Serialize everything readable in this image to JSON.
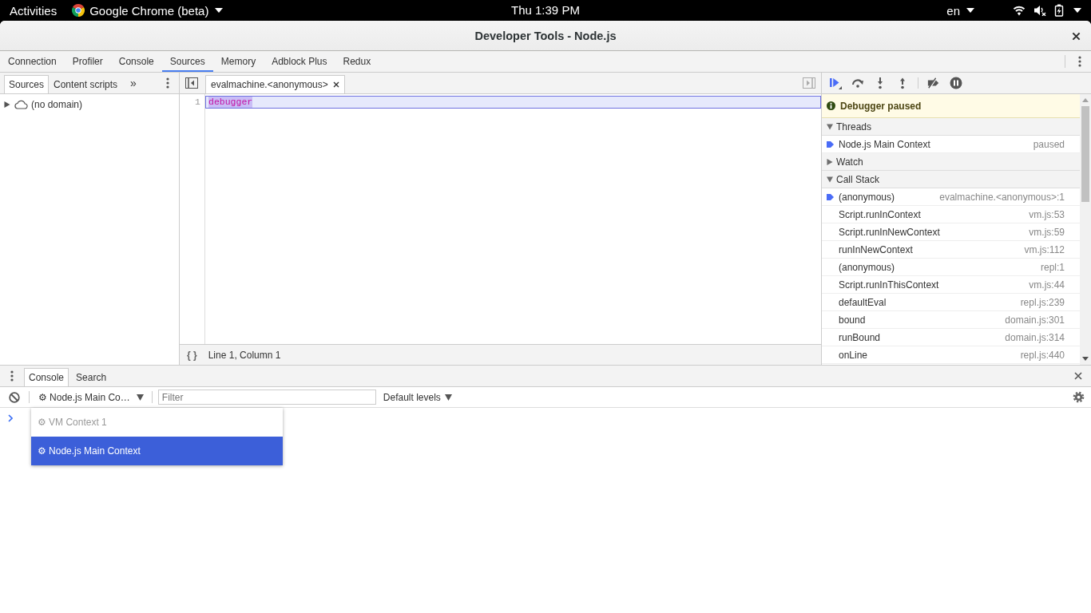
{
  "top_bar": {
    "activities": "Activities",
    "app_menu": "Google Chrome (beta)",
    "clock": "Thu 1:39 PM",
    "language": "en"
  },
  "window": {
    "title": "Developer Tools - Node.js"
  },
  "main_tabs": [
    {
      "label": "Connection",
      "selected": false
    },
    {
      "label": "Profiler",
      "selected": false
    },
    {
      "label": "Console",
      "selected": false
    },
    {
      "label": "Sources",
      "selected": true
    },
    {
      "label": "Memory",
      "selected": false
    },
    {
      "label": "Adblock Plus",
      "selected": false
    },
    {
      "label": "Redux",
      "selected": false
    }
  ],
  "navigator": {
    "tabs": [
      {
        "label": "Sources",
        "selected": true
      },
      {
        "label": "Content scripts",
        "selected": false
      }
    ],
    "more": "»",
    "tree": [
      {
        "label": "(no domain)",
        "expanded": false
      }
    ]
  },
  "editor": {
    "tabs": [
      {
        "label": "evalmachine.<anonymous>",
        "selected": true
      }
    ],
    "lines": [
      {
        "number": "1",
        "code": "debugger",
        "current": true
      }
    ],
    "format_button": "{ }",
    "status": "Line 1, Column 1"
  },
  "debugger": {
    "banner": "Debugger paused",
    "threads": {
      "title": "Threads",
      "expanded": true,
      "items": [
        {
          "name": "Node.js Main Context",
          "status": "paused",
          "current": true
        }
      ]
    },
    "watch": {
      "title": "Watch",
      "expanded": false
    },
    "call_stack": {
      "title": "Call Stack",
      "expanded": true,
      "frames": [
        {
          "name": "(anonymous)",
          "location": "evalmachine.<anonymous>:1",
          "current": true
        },
        {
          "name": "Script.runInContext",
          "location": "vm.js:53",
          "current": false
        },
        {
          "name": "Script.runInNewContext",
          "location": "vm.js:59",
          "current": false
        },
        {
          "name": "runInNewContext",
          "location": "vm.js:112",
          "current": false
        },
        {
          "name": "(anonymous)",
          "location": "repl:1",
          "current": false
        },
        {
          "name": "Script.runInThisContext",
          "location": "vm.js:44",
          "current": false
        },
        {
          "name": "defaultEval",
          "location": "repl.js:239",
          "current": false
        },
        {
          "name": "bound",
          "location": "domain.js:301",
          "current": false
        },
        {
          "name": "runBound",
          "location": "domain.js:314",
          "current": false
        },
        {
          "name": "onLine",
          "location": "repl.js:440",
          "current": false
        }
      ]
    }
  },
  "drawer": {
    "tabs": [
      {
        "label": "Console",
        "selected": true
      },
      {
        "label": "Search",
        "selected": false
      }
    ],
    "context_selector": "⚙ Node.js Main Co…",
    "filter": {
      "placeholder": "Filter"
    },
    "levels": "Default levels",
    "context_menu": {
      "items": [
        {
          "label": "⚙ VM Context 1",
          "selected": false,
          "disabled": true
        },
        {
          "label": "⚙ Node.js Main Context",
          "selected": true,
          "disabled": false
        }
      ]
    }
  }
}
